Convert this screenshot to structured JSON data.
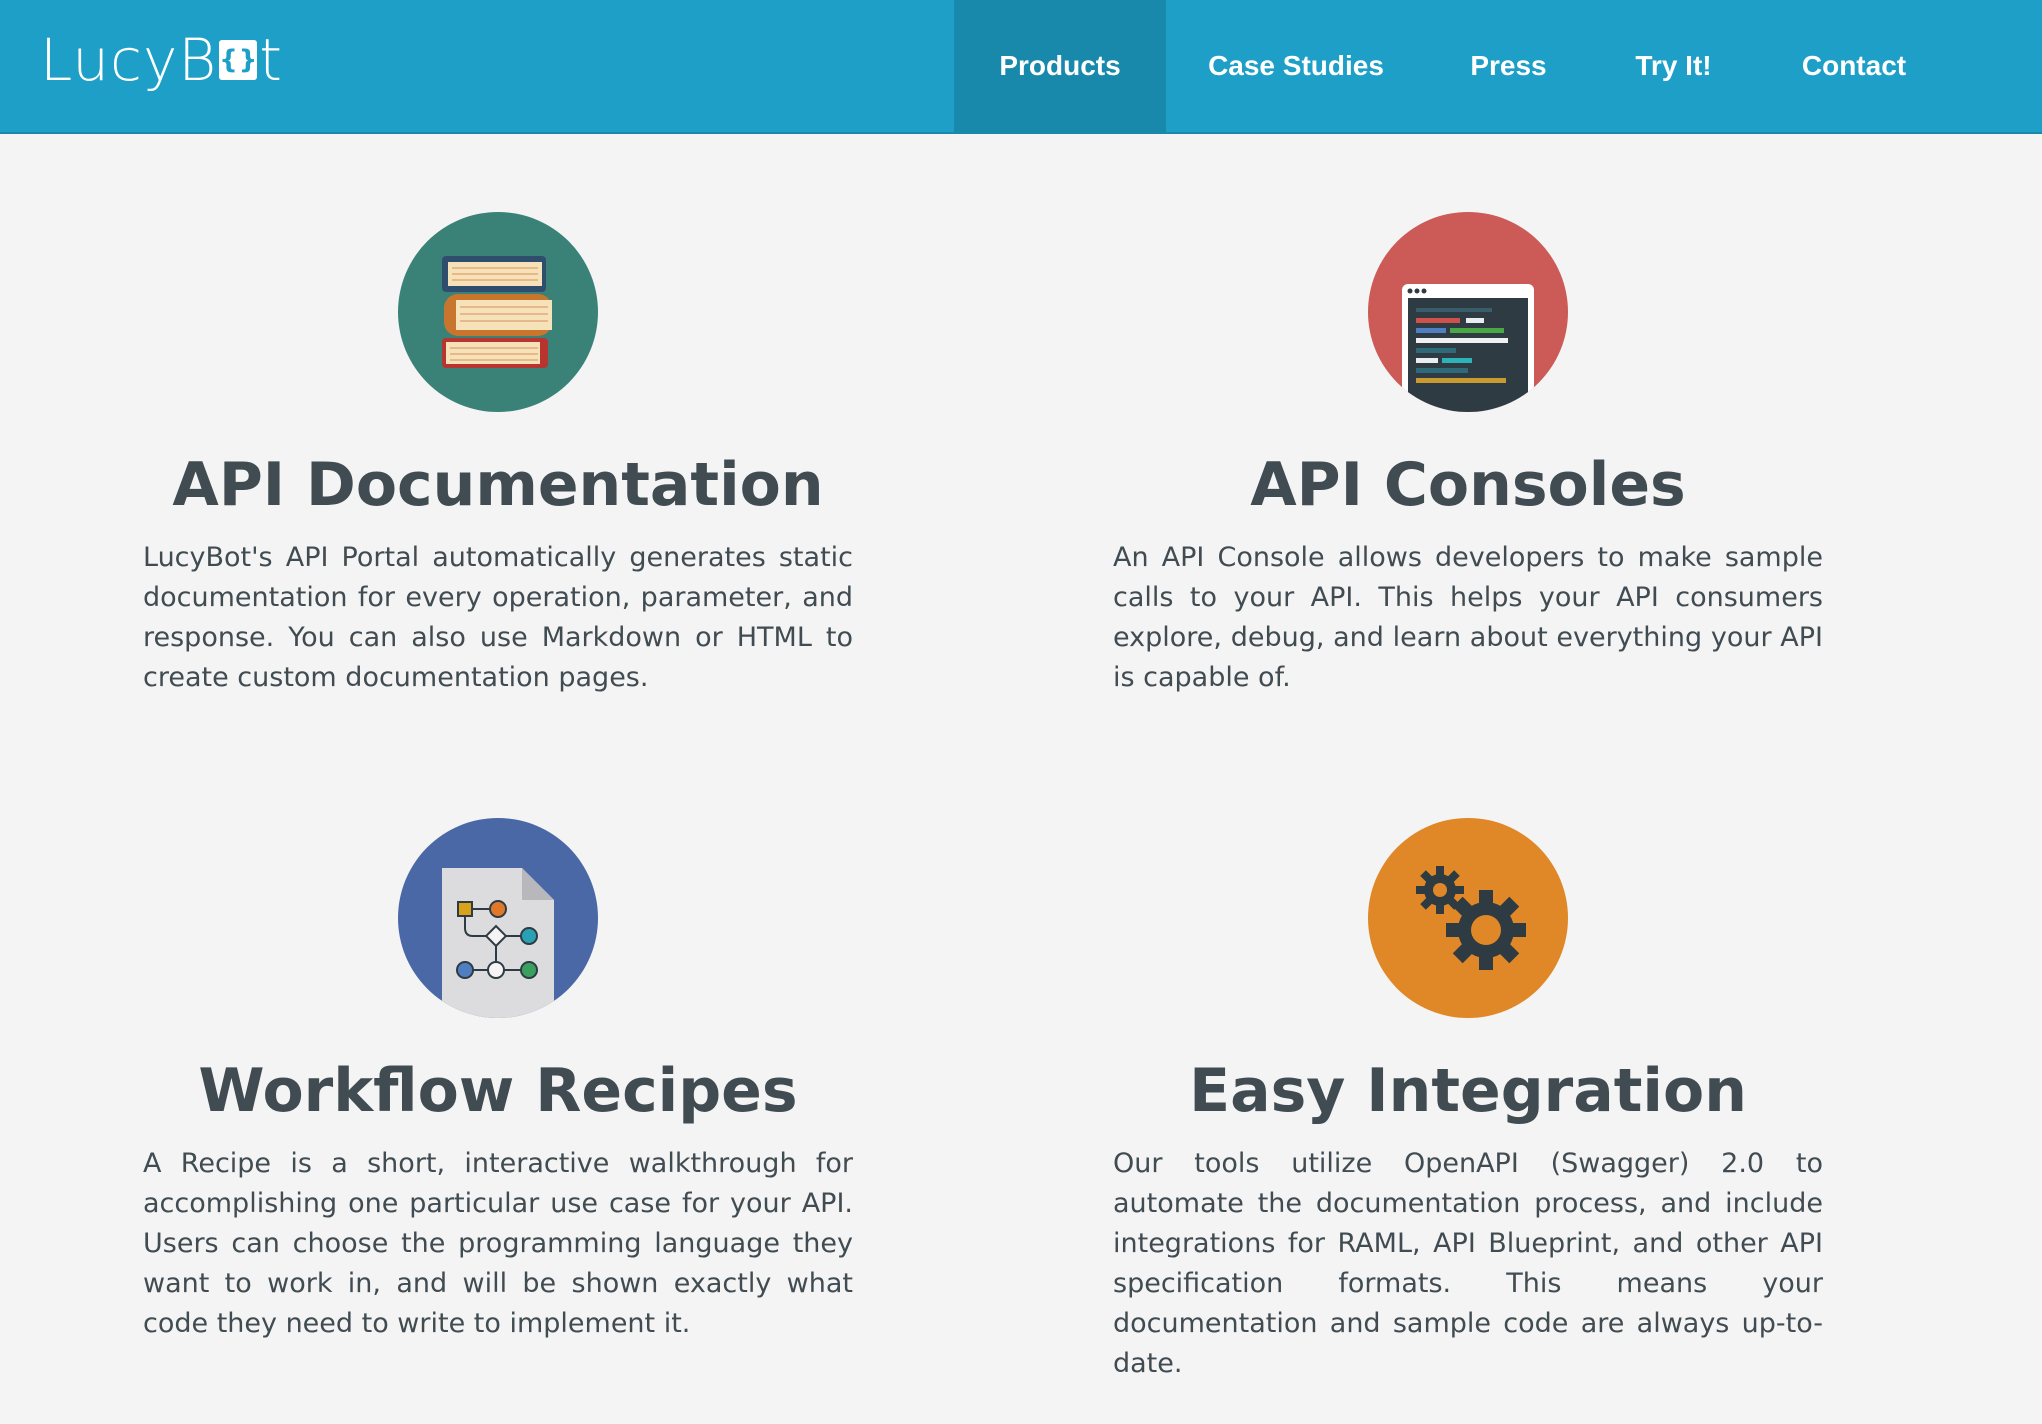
{
  "brand": {
    "logo_text_left": "LucyB",
    "logo_brace": "{}",
    "logo_text_right": "t"
  },
  "nav": {
    "products": "Products",
    "case_studies": "Case Studies",
    "press": "Press",
    "try_it": "Try It!",
    "contact": "Contact"
  },
  "features": [
    {
      "title": "API Documentation",
      "icon": "books-icon",
      "color": "#3a8278",
      "text": "LucyBot's API Portal automatically generates static documentation for every operation, parameter, and response. You can also use Markdown or HTML to create custom documentation pages."
    },
    {
      "title": "API Consoles",
      "icon": "console-icon",
      "color": "#cc5a57",
      "text": "An API Console allows developers to make sample calls to your API. This helps your API consumers explore, debug, and learn about everything your API is capable of."
    },
    {
      "title": "Workflow Recipes",
      "icon": "workflow-icon",
      "color": "#4a68a6",
      "text": "A Recipe is a short, interactive walkthrough for accomplishing one particular use case for your API. Users can choose the programming language they want to work in, and will be shown exactly what code they need to write to implement it."
    },
    {
      "title": "Easy Integration",
      "icon": "gears-icon",
      "color": "#e08727",
      "text": "Our tools utilize OpenAPI (Swagger) 2.0 to automate the documentation process, and include integrations for RAML, API Blueprint, and other API specification formats. This means your documentation and sample code are always up-to-date."
    }
  ]
}
